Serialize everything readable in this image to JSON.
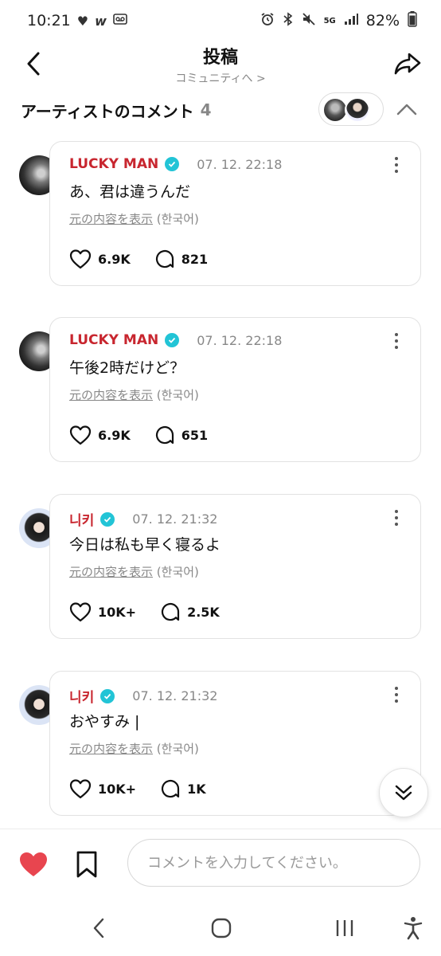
{
  "status_bar": {
    "time": "10:21",
    "battery": "82%",
    "network": "5G"
  },
  "header": {
    "title": "投稿",
    "subtitle": "コミュニティへ >"
  },
  "section": {
    "title": "アーティストのコメント",
    "count": "4"
  },
  "comments": [
    {
      "name": "LUCKY MAN",
      "date": "07. 12. 22:18",
      "text": "あ、君は違うんだ",
      "translate_link": "元の内容を表示",
      "translate_lang": "(한국어)",
      "likes": "6.9K",
      "replies": "821"
    },
    {
      "name": "LUCKY MAN",
      "date": "07. 12. 22:18",
      "text": "午後2時だけど？",
      "translate_link": "元の内容を表示",
      "translate_lang": "(한국어)",
      "likes": "6.9K",
      "replies": "651"
    },
    {
      "name": "니키",
      "date": "07. 12. 21:32",
      "text": "今日は私も早く寝るよ",
      "translate_link": "元の内容を表示",
      "translate_lang": "(한국어)",
      "likes": "10K+",
      "replies": "2.5K"
    },
    {
      "name": "니키",
      "date": "07. 12. 21:32",
      "text": "おやすみ |",
      "translate_link": "元の内容を表示",
      "translate_lang": "(한국어)",
      "likes": "10K+",
      "replies": "1K"
    }
  ],
  "composer": {
    "placeholder": "コメントを入力してください。"
  },
  "colors": {
    "name": "#c8262f",
    "verified": "#22c4d6",
    "heart": "#e8454f"
  },
  "icons": [
    "heart-icon",
    "wattpad-icon",
    "voicemail-icon",
    "alarm-icon",
    "bluetooth-icon",
    "mute-icon",
    "signal-icon",
    "battery-icon",
    "back-arrow-icon",
    "share-icon",
    "chevron-up-icon",
    "verified-icon",
    "more-icon",
    "like-icon",
    "reply-icon",
    "double-chevron-down-icon",
    "bookmark-icon",
    "nav-back-icon",
    "nav-home-icon",
    "nav-recents-icon",
    "accessibility-icon"
  ]
}
